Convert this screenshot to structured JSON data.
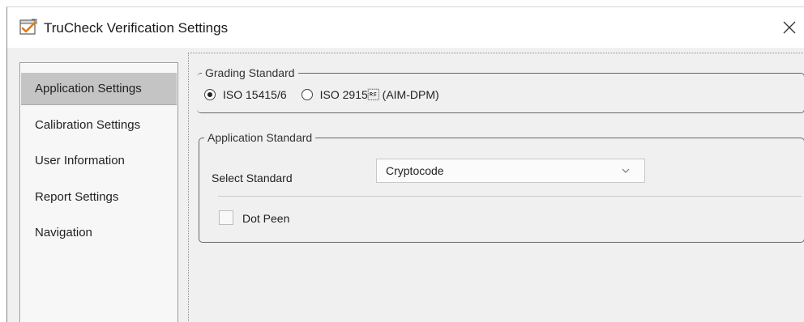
{
  "window": {
    "title": "TruCheck Verification Settings",
    "close_symbol": "✕"
  },
  "sidebar": {
    "items": [
      {
        "label": "Application Settings",
        "selected": true
      },
      {
        "label": "Calibration Settings",
        "selected": false
      },
      {
        "label": "User Information",
        "selected": false
      },
      {
        "label": "Report Settings",
        "selected": false
      },
      {
        "label": "Navigation",
        "selected": false
      }
    ]
  },
  "grading_standard": {
    "legend": "Grading Standard",
    "options": [
      {
        "label": "ISO 15415/6",
        "checked": true
      },
      {
        "label": "ISO 2915\u001e (AIM-DPM)",
        "checked": false
      }
    ]
  },
  "application_standard": {
    "legend": "Application Standard",
    "select_label": "Select Standard",
    "select_value": "Cryptocode",
    "dot_peen_label": "Dot Peen",
    "dot_peen_checked": false
  },
  "icons": {
    "app": "trucheck-app-icon",
    "close": "close-icon",
    "dropdown": "chevron-down-icon"
  },
  "colors": {
    "selected_nav": "#c4c4c4",
    "client_background": "#f0f0f0"
  }
}
